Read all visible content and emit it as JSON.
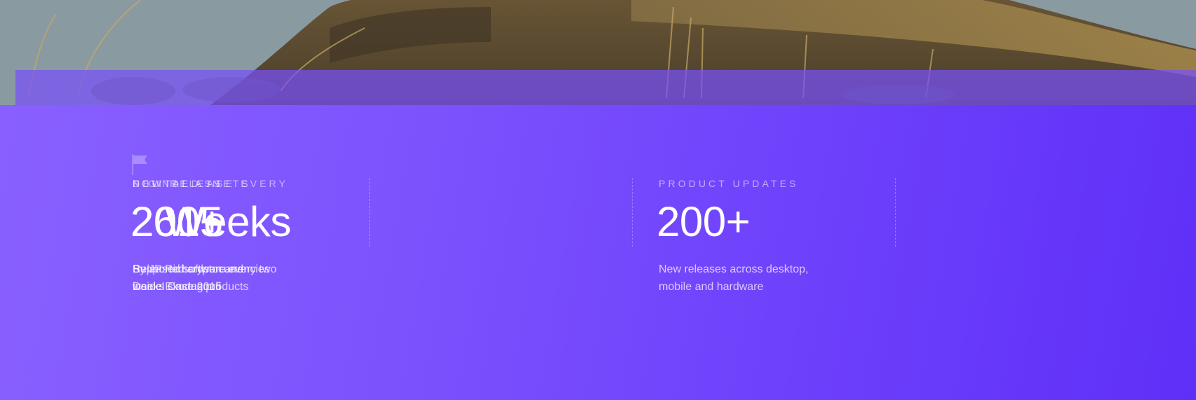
{
  "colors": {
    "panel_start": "#8960ff",
    "panel_end": "#5f2ff8",
    "band": "#7850fa"
  },
  "hero": {
    "image": "hillside-grass-photo"
  },
  "icons": {
    "flag": "flag-icon"
  },
  "stats": [
    {
      "label": "FOUNDED IN",
      "value": "2015",
      "desc_line1": "By JP Richardson and",
      "desc_line2": "Daniel Castagnoli"
    },
    {
      "label": "PRODUCT UPDATES",
      "value": "200+",
      "desc_line1": "New releases across desktop,",
      "desc_line2": "mobile and hardware"
    },
    {
      "label": "NEW RELEASE EVERY",
      "value": "2 Weeks",
      "desc_line1": "Released software every two",
      "desc_line2": "weeks since 2015"
    },
    {
      "label": "DIGITAL ASSETS",
      "value": "260+",
      "desc_line1": "Supported cryptocurrencies",
      "desc_line2": "inside Exodus products"
    }
  ]
}
